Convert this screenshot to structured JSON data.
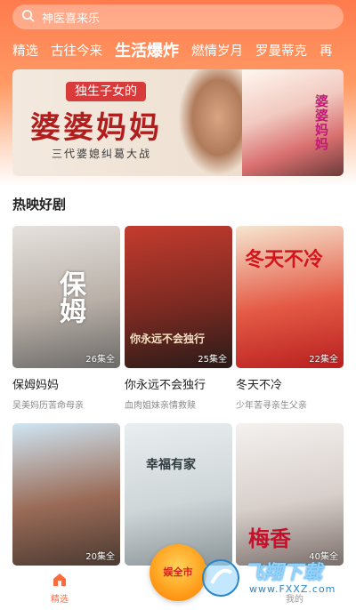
{
  "search": {
    "placeholder": "神医喜来乐"
  },
  "tabs": [
    {
      "label": "精选"
    },
    {
      "label": "古往今来"
    },
    {
      "label": "生活爆炸",
      "active": true
    },
    {
      "label": "燃情岁月"
    },
    {
      "label": "罗曼蒂克"
    },
    {
      "label": "再"
    }
  ],
  "banner": {
    "sub_title": "独生子女的",
    "title": "婆婆妈妈",
    "line": "三代婆媳纠葛大战",
    "poster_text": "婆婆妈妈"
  },
  "section": {
    "title": "热映好剧"
  },
  "dramas": [
    {
      "title": "保姆妈妈",
      "desc": "吴美妈历苦命母亲",
      "episodes": "26集全",
      "poster_text": "保姆",
      "colors": [
        "#e6e2de",
        "#b9b0a8",
        "#6c6a68"
      ]
    },
    {
      "title": "你永远不会独行",
      "desc": "血肉姐妹亲情救赎",
      "episodes": "25集全",
      "poster_text": "你永远不会独行",
      "colors": [
        "#c43b2e",
        "#7c2a22",
        "#2a1b18"
      ]
    },
    {
      "title": "冬天不冷",
      "desc": "少年苦寻亲生父亲",
      "episodes": "22集全",
      "poster_text": "冬天不冷",
      "colors": [
        "#f6e6d0",
        "#e45a45",
        "#b81f1f"
      ]
    },
    {
      "title": "",
      "desc": "",
      "episodes": "20集全",
      "poster_text": "",
      "colors": [
        "#cfe6f4",
        "#9a6b57",
        "#4b3a32"
      ]
    },
    {
      "title": "",
      "desc": "",
      "episodes": "",
      "poster_text": "幸福有家",
      "colors": [
        "#e9eef0",
        "#cfd6d8",
        "#8a9498"
      ]
    },
    {
      "title": "",
      "desc": "",
      "episodes": "40集全",
      "poster_text": "梅香",
      "colors": [
        "#f4f1ee",
        "#d8cfcb",
        "#7a6e69"
      ]
    }
  ],
  "bottom_nav": {
    "home": {
      "label": "精选"
    },
    "center": {
      "label": "娱全市"
    },
    "right": {
      "label": "我的"
    }
  },
  "watermark": {
    "main": "飞翔下载",
    "sub": "www.FXXZ.com"
  },
  "colors": {
    "accent": "#ff6a3d",
    "header_top": "#ff7b4e"
  }
}
